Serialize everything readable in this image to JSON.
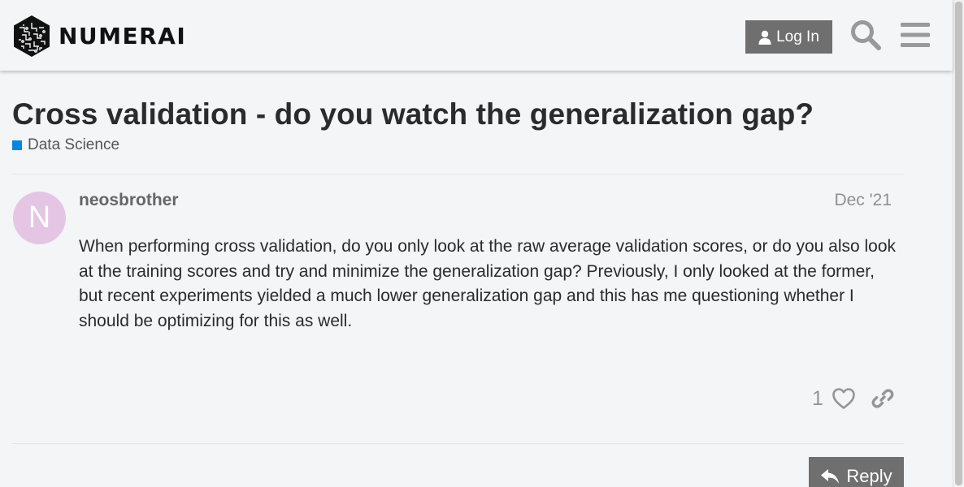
{
  "header": {
    "brand": "NUMERAI",
    "login_label": "Log In",
    "icons": {
      "user": "user-icon",
      "search": "search-icon",
      "menu": "hamburger-menu-icon"
    }
  },
  "topic": {
    "title": "Cross validation - do you watch the generalization gap?",
    "category": "Data Science",
    "category_color": "#0b85d8"
  },
  "post": {
    "avatar_letter": "N",
    "avatar_color": "#e4c6e4",
    "username": "neosbrother",
    "date": "Dec '21",
    "body": "When performing cross validation, do you only look at the raw average validation scores, or do you also look at the training scores and try and minimize the generalization gap? Previously, I only looked at the former, but recent experiments yielded a much lower generalization gap and this has me questioning whether I should be optimizing for this as well.",
    "like_count": "1",
    "icons": {
      "like": "heart-icon",
      "share": "link-icon"
    }
  },
  "footer": {
    "reply_label": "Reply",
    "icons": {
      "reply": "reply-icon"
    }
  }
}
